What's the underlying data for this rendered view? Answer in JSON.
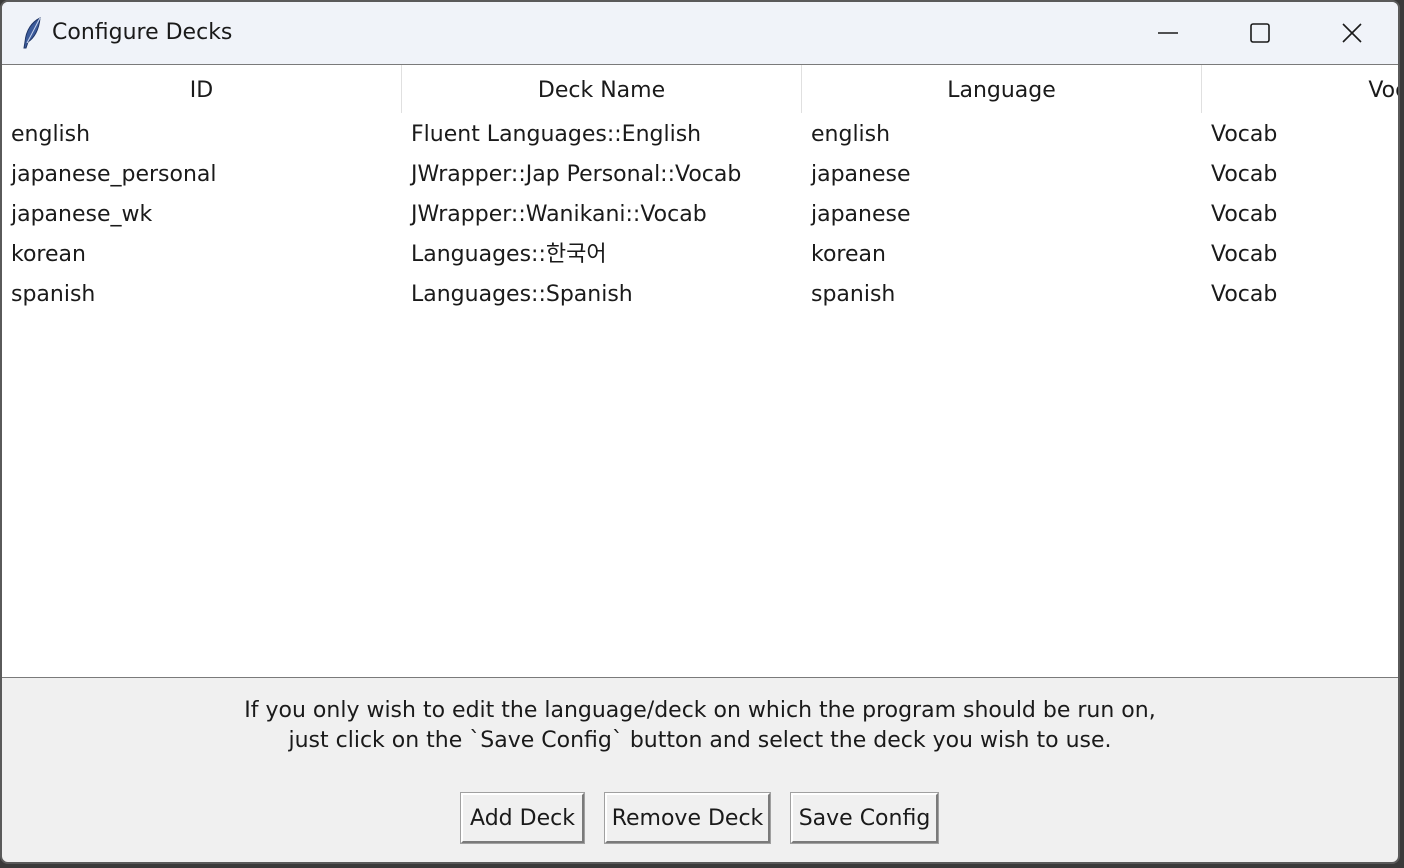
{
  "window": {
    "title": "Configure Decks",
    "icon": "feather-icon"
  },
  "titlebar_controls": {
    "minimize": "minimize-icon",
    "maximize": "maximize-icon",
    "close": "close-icon"
  },
  "table": {
    "columns": [
      "ID",
      "Deck Name",
      "Language",
      "Vocab"
    ],
    "rows": [
      [
        "english",
        "Fluent Languages::English",
        "english",
        "Vocab"
      ],
      [
        "japanese_personal",
        "JWrapper::Jap Personal::Vocab",
        "japanese",
        "Vocab"
      ],
      [
        "japanese_wk",
        "JWrapper::Wanikani::Vocab",
        "japanese",
        "Vocab"
      ],
      [
        "korean",
        "Languages::한국어",
        "korean",
        "Vocab"
      ],
      [
        "spanish",
        "Languages::Spanish",
        "spanish",
        "Vocab"
      ]
    ]
  },
  "instructions": {
    "line1": "If you only wish to edit the language/deck on which the program should be run on,",
    "line2": "just click on the `Save Config` button and select the deck you wish to use."
  },
  "buttons": {
    "add": "Add Deck",
    "remove": "Remove Deck",
    "save": "Save Config"
  }
}
